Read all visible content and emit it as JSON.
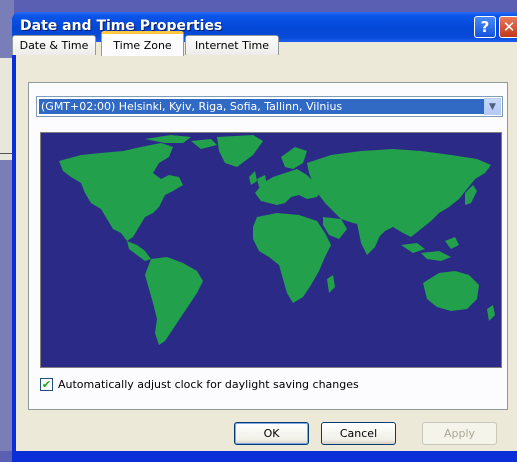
{
  "window": {
    "title": "Date and Time Properties",
    "help_glyph": "?",
    "close_glyph": "✕"
  },
  "tabs": [
    {
      "label": "Date & Time",
      "selected": false
    },
    {
      "label": "Time Zone",
      "selected": true
    },
    {
      "label": "Internet Time",
      "selected": false
    }
  ],
  "timezone": {
    "selected": "(GMT+02:00) Helsinki, Kyiv, Riga, Sofia, Tallinn, Vilnius"
  },
  "daylight": {
    "checked": true,
    "check_glyph": "✔",
    "label": "Automatically adjust clock for daylight saving changes"
  },
  "buttons": {
    "ok": "OK",
    "cancel": "Cancel",
    "apply": "Apply"
  },
  "colors": {
    "map_ocean": "#2b2b87",
    "map_land": "#22a04b",
    "selection": "#316ac5",
    "title_bar": "#0347d6"
  },
  "icons": {
    "dropdown": "chevron-down-icon",
    "help": "help-icon",
    "close": "close-icon",
    "checkbox": "checkmark-icon"
  }
}
